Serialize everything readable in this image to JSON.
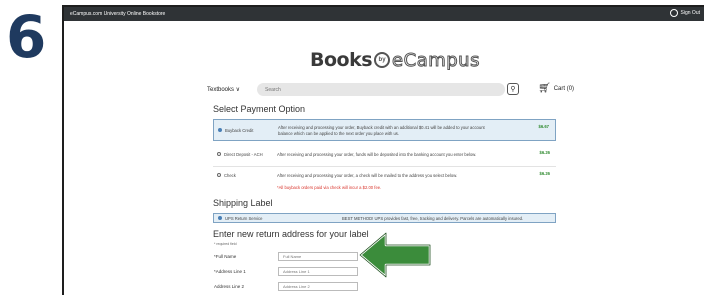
{
  "step_number": "6",
  "topbar": {
    "site_title": "eCampus.com University Online Bookstore",
    "sign_out": "Sign Out"
  },
  "logo": {
    "books": "Books",
    "by": "by",
    "ecampus": "eCampus"
  },
  "nav": {
    "textbooks": "Textbooks ∨",
    "search_placeholder": "Search",
    "cart": "Cart (0)"
  },
  "payment": {
    "title": "Select Payment Option",
    "options": [
      {
        "label": "Buyback Credit",
        "desc": "After receiving and processing your order, Buyback credit with an additional $0.41 will be added to your account balance which can be applied to the next order you place with us.",
        "amount": "$6.67",
        "selected": true
      },
      {
        "label": "Direct Deposit - ACH",
        "desc": "After receiving and processing your order, funds will be deposited into the banking account you enter below.",
        "amount": "$6.26",
        "selected": false
      },
      {
        "label": "Check",
        "desc": "After receiving and processing your order, a check will be mailed to the address you select below.",
        "amount": "$6.26",
        "note": "*All buyback orders paid via check will incur a $2.00 fee.",
        "selected": false
      }
    ]
  },
  "shipping": {
    "title": "Shipping Label",
    "option_label": "UPS Return Service",
    "option_desc": "BEST METHOD! UPS provides fast, free, tracking and delivery. Parcels are automatically insured."
  },
  "address": {
    "title": "Enter new return address for your label",
    "required_note": "* required field",
    "fields": [
      {
        "label": "*Full Name",
        "placeholder": "Full Name"
      },
      {
        "label": "*Address Line 1",
        "placeholder": "Address Line 1"
      },
      {
        "label": "Address Line 2",
        "placeholder": "Address Line 2"
      }
    ]
  },
  "colors": {
    "step": "#1f3a5f",
    "arrow": "#3b8c3b",
    "topbar": "#2f3336",
    "selected_bg": "#e3eef6",
    "amount": "#2f8a2f"
  }
}
